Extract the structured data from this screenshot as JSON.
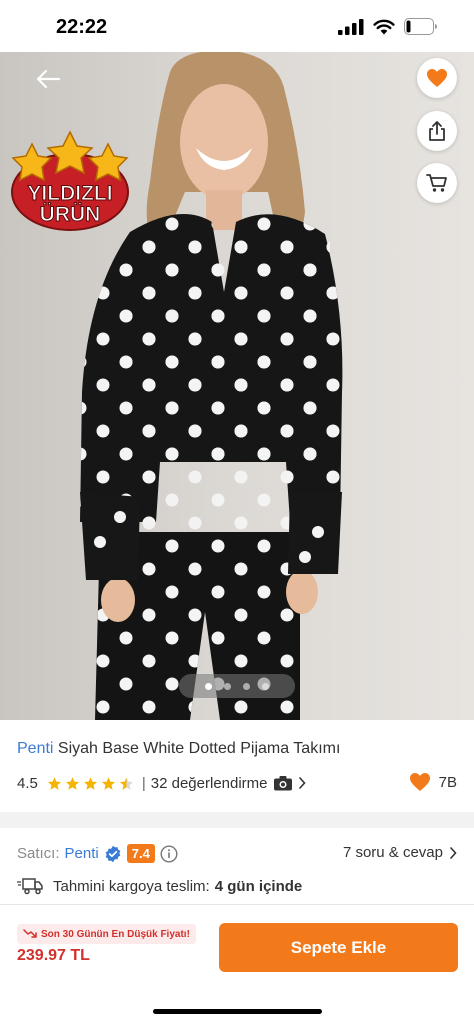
{
  "status_bar": {
    "time": "22:22"
  },
  "hero": {
    "badge_line1": "YILDIZLI",
    "badge_line2": "ÜRÜN",
    "page_count": 4,
    "active_page": 1
  },
  "product": {
    "brand": "Penti",
    "name": "Siyah Base White Dotted Pijama Takımı",
    "rating": "4.5",
    "rating_stars": 4.5,
    "review_separator": "|",
    "review_text": "32 değerlendirme",
    "favorite_count": "7B"
  },
  "seller": {
    "label": "Satıcı:",
    "name": "Penti",
    "score": "7.4",
    "qa_link": "7 soru & cevap",
    "delivery_label": "Tahmini kargoya teslim:",
    "delivery_value": "4 gün içinde"
  },
  "bottom": {
    "lowest_price_badge": "Son 30 Günün En Düşük Fiyatı!",
    "price": "239.97 TL",
    "add_to_cart": "Sepete Ekle"
  },
  "colors": {
    "brand_blue": "#3a7bd5",
    "accent_orange": "#f27a1a",
    "price_red": "#d0312d",
    "star_yellow": "#f5b400"
  }
}
